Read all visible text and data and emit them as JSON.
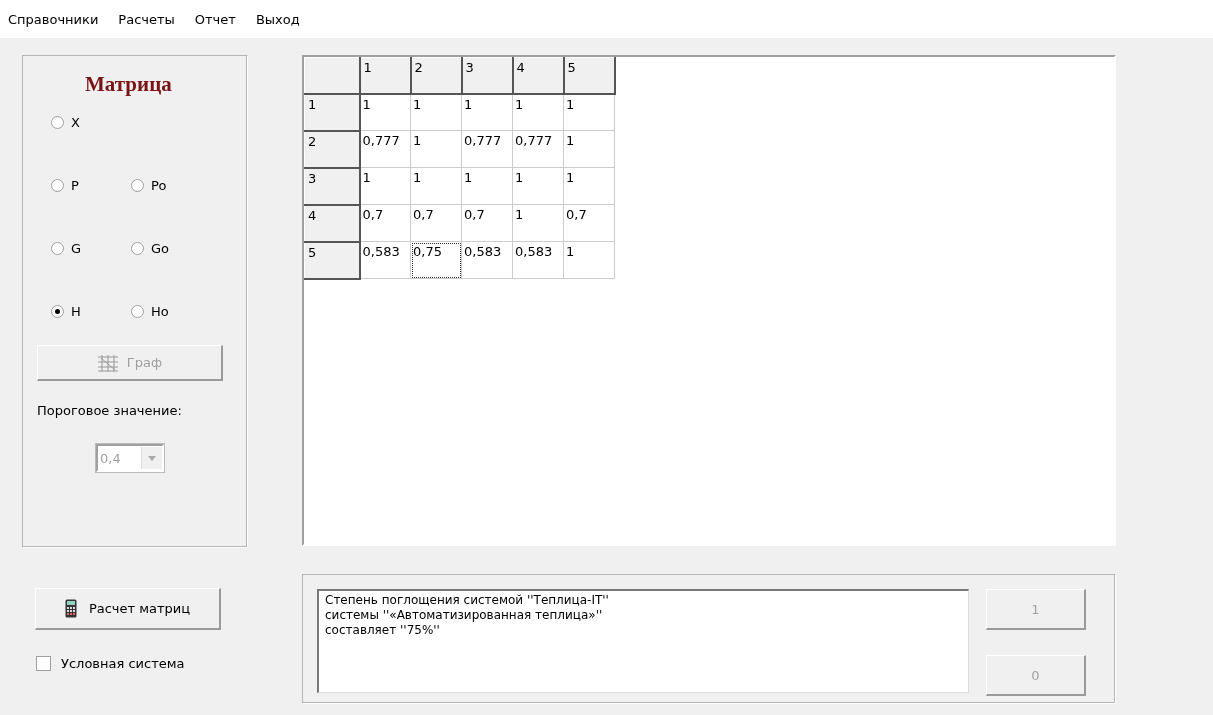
{
  "menu": [
    {
      "label": "Справочники"
    },
    {
      "label": "Расчеты"
    },
    {
      "label": "Отчет"
    },
    {
      "label": "Выход"
    }
  ],
  "matrix_panel": {
    "title": "Матрица",
    "radios": [
      [
        {
          "label": "X",
          "selected": false
        }
      ],
      [
        {
          "label": "P",
          "selected": false
        },
        {
          "label": "Po",
          "selected": false
        }
      ],
      [
        {
          "label": "G",
          "selected": false
        },
        {
          "label": "Go",
          "selected": false
        }
      ],
      [
        {
          "label": "H",
          "selected": true
        },
        {
          "label": "Ho",
          "selected": false
        }
      ]
    ],
    "graph_button": {
      "label": "Граф",
      "disabled": true
    },
    "threshold_label": "Пороговое значение:",
    "threshold_combo": {
      "value": "0,4",
      "disabled": true
    }
  },
  "table": {
    "columns": [
      "1",
      "2",
      "3",
      "4",
      "5"
    ],
    "rows": [
      {
        "header": "1",
        "cells": [
          {
            "text": "1",
            "focused": false
          },
          {
            "text": "1",
            "focused": false
          },
          {
            "text": "1",
            "focused": false
          },
          {
            "text": "1",
            "focused": false
          },
          {
            "text": "1",
            "focused": false
          }
        ]
      },
      {
        "header": "2",
        "cells": [
          {
            "text": "0,777",
            "focused": false
          },
          {
            "text": "1",
            "focused": false
          },
          {
            "text": "0,777",
            "focused": false
          },
          {
            "text": "0,777",
            "focused": false
          },
          {
            "text": "1",
            "focused": false
          }
        ]
      },
      {
        "header": "3",
        "cells": [
          {
            "text": "1",
            "focused": false
          },
          {
            "text": "1",
            "focused": false
          },
          {
            "text": "1",
            "focused": false
          },
          {
            "text": "1",
            "focused": false
          },
          {
            "text": "1",
            "focused": false
          }
        ]
      },
      {
        "header": "4",
        "cells": [
          {
            "text": "0,7",
            "focused": false
          },
          {
            "text": "0,7",
            "focused": false
          },
          {
            "text": "0,7",
            "focused": false
          },
          {
            "text": "1",
            "focused": false
          },
          {
            "text": "0,7",
            "focused": false
          }
        ]
      },
      {
        "header": "5",
        "cells": [
          {
            "text": "0,583",
            "focused": false
          },
          {
            "text": "0,75",
            "focused": true
          },
          {
            "text": "0,583",
            "focused": false
          },
          {
            "text": "0,583",
            "focused": false
          },
          {
            "text": "1",
            "focused": false
          }
        ]
      }
    ]
  },
  "calc_button": {
    "label": "Расчет матриц"
  },
  "conditional_checkbox": {
    "label": "Условная система",
    "checked": false
  },
  "result_memo": {
    "lines": [
      "Степень поглощения системой ''Теплица-IT''",
      "системы ''«Автоматизированная теплица»''",
      "составляет ''75%''"
    ]
  },
  "answer_buttons": [
    {
      "label": "1",
      "disabled": true
    },
    {
      "label": "0",
      "disabled": true
    }
  ]
}
